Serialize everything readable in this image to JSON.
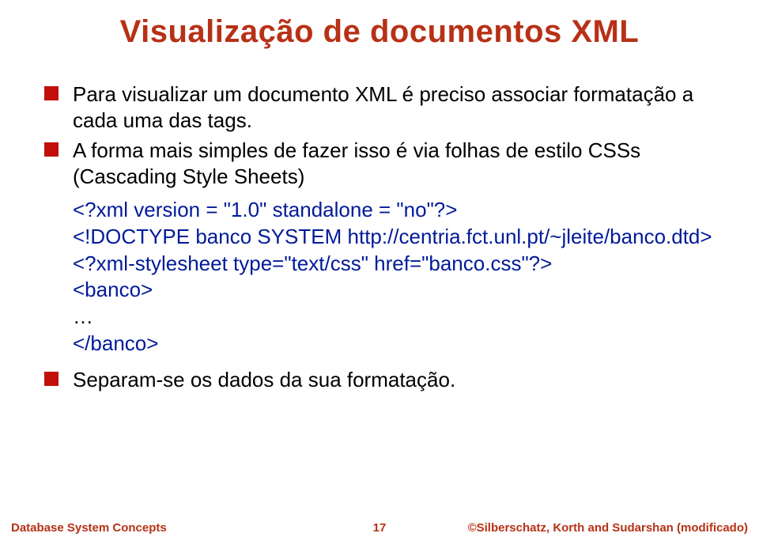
{
  "title": "Visualização de documentos XML",
  "bullets": {
    "b1": "Para visualizar um documento XML é preciso associar formatação a cada uma das tags.",
    "b2": "A forma mais simples de fazer isso é via folhas de estilo CSSs (Cascading Style Sheets)",
    "b3": "Separam-se os dados da sua formatação."
  },
  "code": {
    "l1": "<?xml version = \"1.0\" standalone = \"no\"?>",
    "l2": "<!DOCTYPE banco SYSTEM http://centria.fct.unl.pt/~jleite/banco.dtd>",
    "l3": "<?xml-stylesheet type=\"text/css\" href=\"banco.css\"?>",
    "l4": "<banco>",
    "l5": "…",
    "l6": "</banco>"
  },
  "footer": {
    "left": "Database System Concepts",
    "center": "17",
    "right": "©Silberschatz, Korth and Sudarshan (modificado)"
  }
}
